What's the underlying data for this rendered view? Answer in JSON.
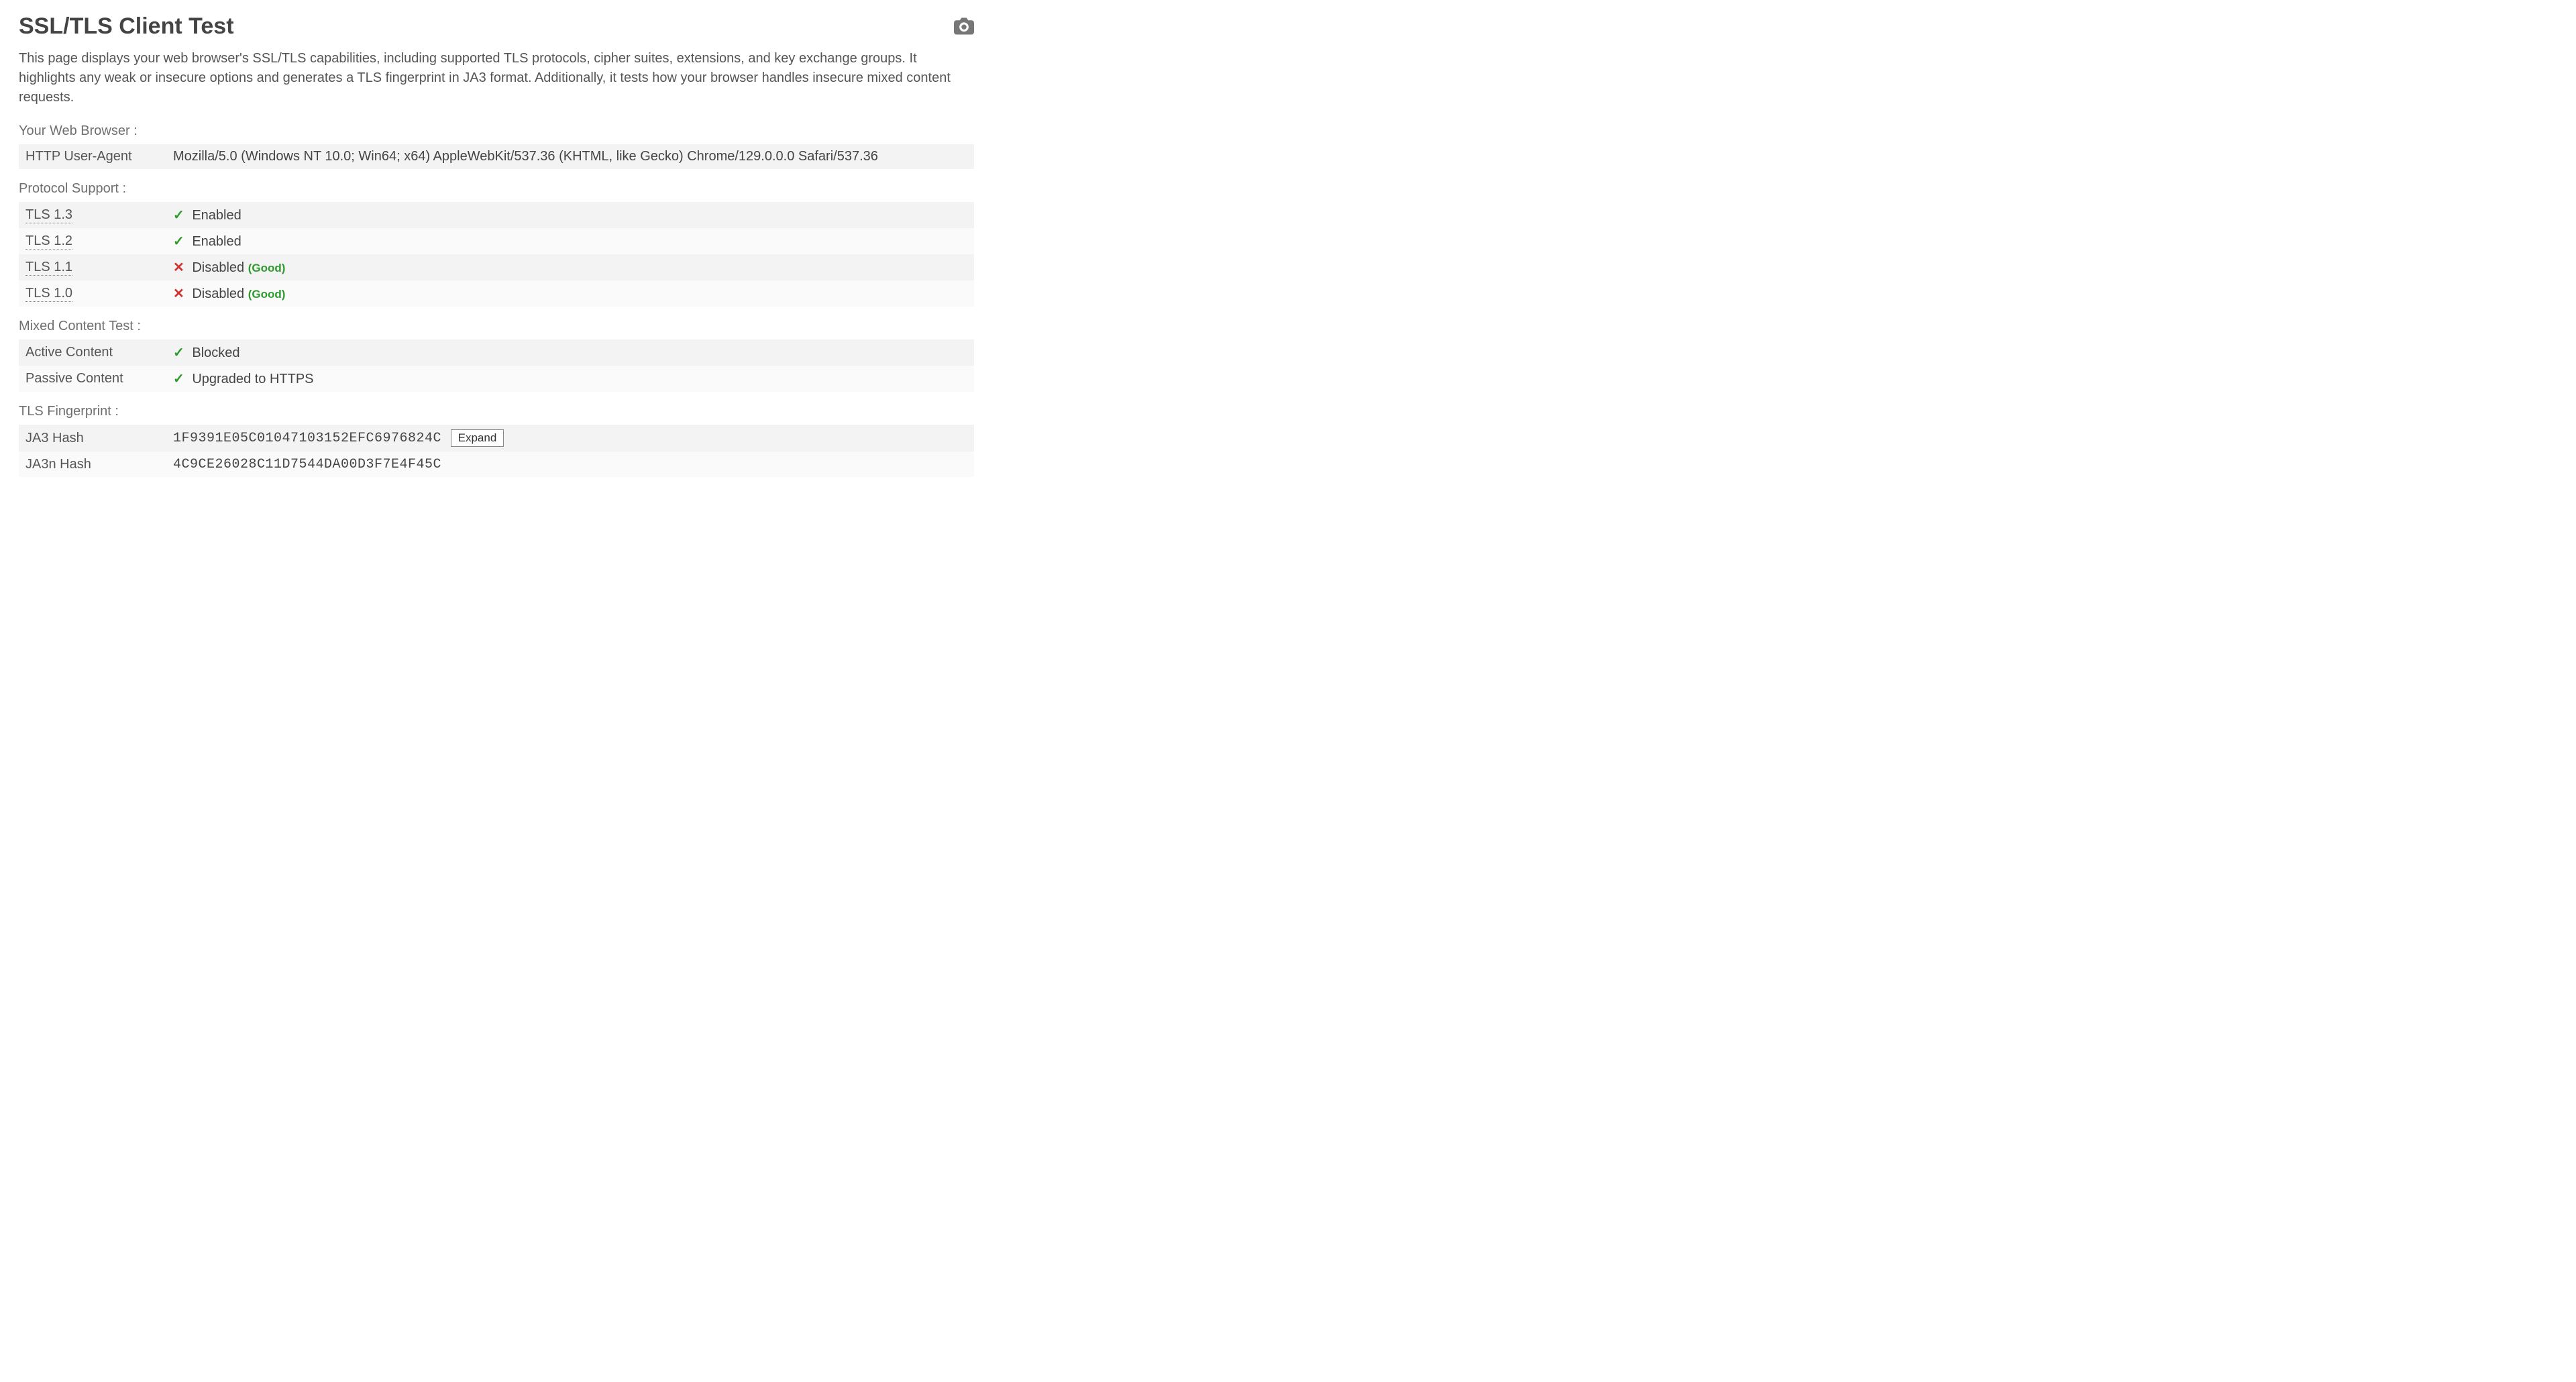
{
  "header": {
    "title": "SSL/TLS Client Test",
    "screenshot_label": "Screenshot"
  },
  "intro": "This page displays your web browser's SSL/TLS capabilities, including supported TLS protocols, cipher suites, extensions, and key exchange groups. It highlights any weak or insecure options and generates a TLS fingerprint in JA3 format. Additionally, it tests how your browser handles insecure mixed content requests.",
  "sections": {
    "browser": {
      "title": "Your Web Browser :",
      "user_agent_label": "HTTP User-Agent",
      "user_agent_value": "Mozilla/5.0 (Windows NT 10.0; Win64; x64) AppleWebKit/537.36 (KHTML, like Gecko) Chrome/129.0.0.0 Safari/537.36"
    },
    "protocol": {
      "title": "Protocol Support :",
      "rows": [
        {
          "name": "TLS 1.3",
          "status": "Enabled",
          "ok": true,
          "note": ""
        },
        {
          "name": "TLS 1.2",
          "status": "Enabled",
          "ok": true,
          "note": ""
        },
        {
          "name": "TLS 1.1",
          "status": "Disabled",
          "ok": false,
          "note": "(Good)"
        },
        {
          "name": "TLS 1.0",
          "status": "Disabled",
          "ok": false,
          "note": "(Good)"
        }
      ]
    },
    "mixed": {
      "title": "Mixed Content Test :",
      "rows": [
        {
          "name": "Active Content",
          "status": "Blocked"
        },
        {
          "name": "Passive Content",
          "status": "Upgraded to HTTPS"
        }
      ]
    },
    "fingerprint": {
      "title": "TLS Fingerprint :",
      "ja3_label": "JA3 Hash",
      "ja3_value": "1F9391E05C01047103152EFC6976824C",
      "expand_label": "Expand",
      "ja3n_label": "JA3n Hash",
      "ja3n_value": "4C9CE26028C11D7544DA00D3F7E4F45C"
    }
  }
}
